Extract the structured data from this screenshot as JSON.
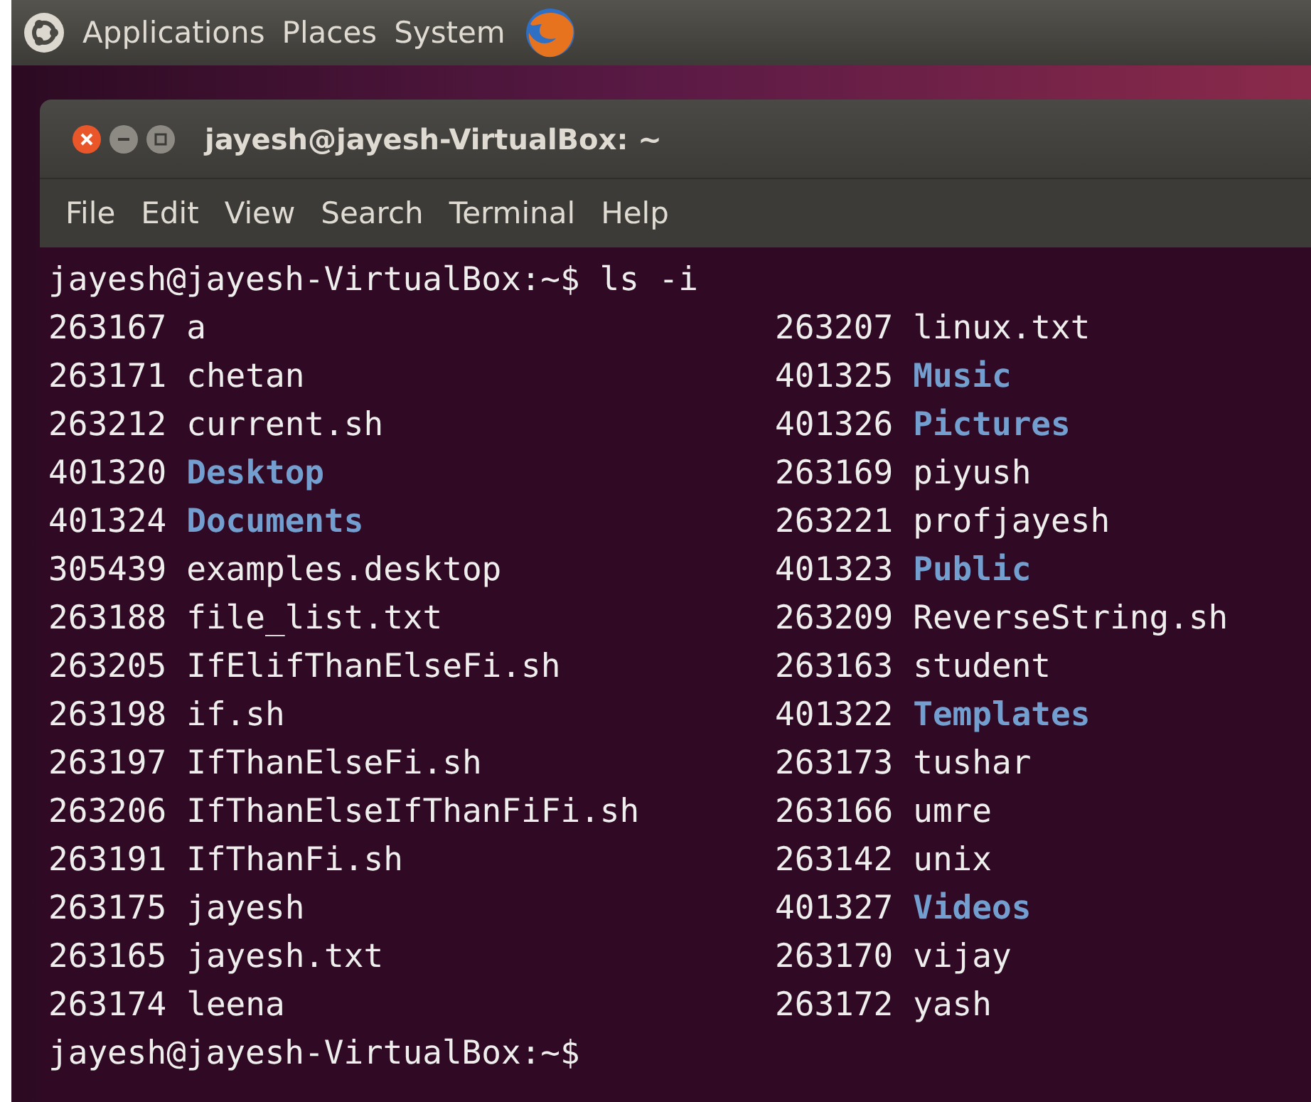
{
  "top_panel": {
    "menus": [
      "Applications",
      "Places",
      "System"
    ]
  },
  "window": {
    "title": "jayesh@jayesh-VirtualBox: ~"
  },
  "menu_bar": [
    "File",
    "Edit",
    "View",
    "Search",
    "Terminal",
    "Help"
  ],
  "terminal": {
    "command_line": "jayesh@jayesh-VirtualBox:~$ ls -i",
    "rows": [
      {
        "left": {
          "inode": "263167",
          "name": "a",
          "kind": "file"
        },
        "right": {
          "inode": "263207",
          "name": "linux.txt",
          "kind": "file"
        }
      },
      {
        "left": {
          "inode": "263171",
          "name": "chetan",
          "kind": "file"
        },
        "right": {
          "inode": "401325",
          "name": "Music",
          "kind": "directory"
        }
      },
      {
        "left": {
          "inode": "263212",
          "name": "current.sh",
          "kind": "file"
        },
        "right": {
          "inode": "401326",
          "name": "Pictures",
          "kind": "directory"
        }
      },
      {
        "left": {
          "inode": "401320",
          "name": "Desktop",
          "kind": "directory"
        },
        "right": {
          "inode": "263169",
          "name": "piyush",
          "kind": "file"
        }
      },
      {
        "left": {
          "inode": "401324",
          "name": "Documents",
          "kind": "directory"
        },
        "right": {
          "inode": "263221",
          "name": "profjayesh",
          "kind": "file"
        }
      },
      {
        "left": {
          "inode": "305439",
          "name": "examples.desktop",
          "kind": "file"
        },
        "right": {
          "inode": "401323",
          "name": "Public",
          "kind": "directory"
        }
      },
      {
        "left": {
          "inode": "263188",
          "name": "file_list.txt",
          "kind": "file"
        },
        "right": {
          "inode": "263209",
          "name": "ReverseString.sh",
          "kind": "file"
        }
      },
      {
        "left": {
          "inode": "263205",
          "name": "IfElifThanElseFi.sh",
          "kind": "file"
        },
        "right": {
          "inode": "263163",
          "name": "student",
          "kind": "file"
        }
      },
      {
        "left": {
          "inode": "263198",
          "name": "if.sh",
          "kind": "file"
        },
        "right": {
          "inode": "401322",
          "name": "Templates",
          "kind": "directory"
        }
      },
      {
        "left": {
          "inode": "263197",
          "name": "IfThanElseFi.sh",
          "kind": "file"
        },
        "right": {
          "inode": "263173",
          "name": "tushar",
          "kind": "file"
        }
      },
      {
        "left": {
          "inode": "263206",
          "name": "IfThanElseIfThanFiFi.sh",
          "kind": "file"
        },
        "right": {
          "inode": "263166",
          "name": "umre",
          "kind": "file"
        }
      },
      {
        "left": {
          "inode": "263191",
          "name": "IfThanFi.sh",
          "kind": "file"
        },
        "right": {
          "inode": "263142",
          "name": "unix",
          "kind": "file"
        }
      },
      {
        "left": {
          "inode": "263175",
          "name": "jayesh",
          "kind": "file"
        },
        "right": {
          "inode": "401327",
          "name": "Videos",
          "kind": "directory"
        }
      },
      {
        "left": {
          "inode": "263165",
          "name": "jayesh.txt",
          "kind": "file"
        },
        "right": {
          "inode": "263170",
          "name": "vijay",
          "kind": "file"
        }
      },
      {
        "left": {
          "inode": "263174",
          "name": "leena",
          "kind": "file"
        },
        "right": {
          "inode": "263172",
          "name": "yash",
          "kind": "file"
        }
      }
    ],
    "prompt": "jayesh@jayesh-VirtualBox:~$"
  }
}
